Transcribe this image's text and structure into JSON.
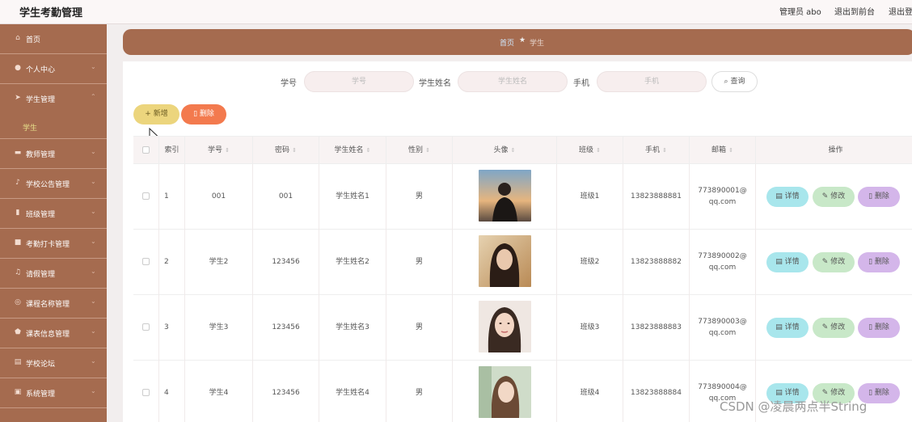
{
  "header": {
    "app_title": "学生考勤管理",
    "admin_label": "管理员 abo",
    "frontend_link": "退出到前台",
    "logout_link": "退出登"
  },
  "sidebar": {
    "items": [
      {
        "label": "首页",
        "icon": "home-icon"
      },
      {
        "label": "个人中心",
        "icon": "user-icon"
      },
      {
        "label": "学生管理",
        "icon": "send-icon"
      },
      {
        "label": "教师管理",
        "icon": "comment-icon"
      },
      {
        "label": "学校公告管理",
        "icon": "mic-icon"
      },
      {
        "label": "班级管理",
        "icon": "bar-chart-icon"
      },
      {
        "label": "考勤打卡管理",
        "icon": "briefcase-icon"
      },
      {
        "label": "请假管理",
        "icon": "bell-icon"
      },
      {
        "label": "课程名称管理",
        "icon": "globe-icon"
      },
      {
        "label": "课表信息管理",
        "icon": "shield-icon"
      },
      {
        "label": "学校论坛",
        "icon": "list-icon"
      },
      {
        "label": "系统管理",
        "icon": "settings-icon"
      }
    ],
    "sub_item": "学生"
  },
  "breadcrumb": {
    "home": "首页",
    "current": "学生"
  },
  "search": {
    "id_label": "学号",
    "id_placeholder": "学号",
    "name_label": "学生姓名",
    "name_placeholder": "学生姓名",
    "phone_label": "手机",
    "phone_placeholder": "手机",
    "query_button": "查询"
  },
  "toolbar": {
    "add_button": "新增",
    "delete_button": "删除"
  },
  "table": {
    "headers": [
      "索引",
      "学号",
      "密码",
      "学生姓名",
      "性别",
      "头像",
      "班级",
      "手机",
      "邮箱",
      "操作"
    ],
    "rows": [
      {
        "index": "1",
        "id": "001",
        "password": "001",
        "name": "学生姓名1",
        "gender": "男",
        "class": "班级1",
        "phone": "13823888881",
        "email": "773890001@qq.com"
      },
      {
        "index": "2",
        "id": "学生2",
        "password": "123456",
        "name": "学生姓名2",
        "gender": "男",
        "class": "班级2",
        "phone": "13823888882",
        "email": "773890002@qq.com"
      },
      {
        "index": "3",
        "id": "学生3",
        "password": "123456",
        "name": "学生姓名3",
        "gender": "男",
        "class": "班级3",
        "phone": "13823888883",
        "email": "773890003@qq.com"
      },
      {
        "index": "4",
        "id": "学生4",
        "password": "123456",
        "name": "学生姓名4",
        "gender": "男",
        "class": "班级4",
        "phone": "13823888884",
        "email": "773890004@qq.com"
      }
    ],
    "actions": {
      "detail": "详情",
      "edit": "修改",
      "delete": "删除"
    }
  },
  "watermark": "CSDN @凌晨两点半String",
  "colors": {
    "sidebar": "#a56b4f",
    "add": "#ecd57d",
    "delete": "#f37a4e",
    "detail": "#a8e6ec",
    "edit": "#c8e8c8",
    "row_delete": "#d4b6ea"
  }
}
